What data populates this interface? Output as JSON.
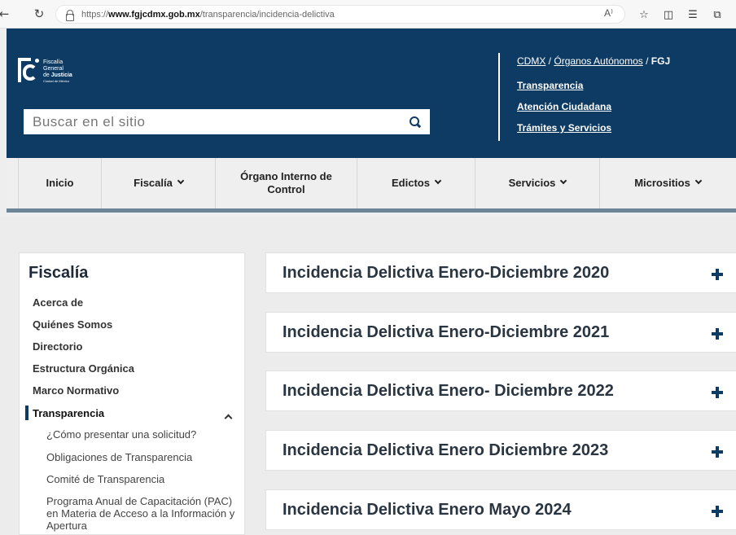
{
  "browser": {
    "url_protocol": "https://",
    "url_host": "www.fgjcdmx.gob.mx",
    "url_path": "/transparencia/incidencia-delictiva",
    "read_aloud_label": "A⁾",
    "toolbar_icons": [
      "favorite-star-icon",
      "split-screen-icon",
      "favorites-list-icon",
      "collections-icon",
      "extensions-icon"
    ]
  },
  "header": {
    "logo": {
      "line1": "Fiscalía",
      "line2": "General",
      "line3_prefix": "de ",
      "line3_bold": "Justicia",
      "line4": "Ciudad de México"
    },
    "search": {
      "placeholder": "Buscar en el sitio"
    },
    "breadcrumb": {
      "part1": "CDMX",
      "sep1": " / ",
      "part2": "Órganos Autónomos",
      "sep2": " / ",
      "part3": "FGJ"
    },
    "links": [
      "Transparencia",
      "Atención Ciudadana",
      "Trámites y Servicios"
    ]
  },
  "main_nav": {
    "items": [
      {
        "label": "Inicio"
      },
      {
        "label": "Fiscalía"
      },
      {
        "label": "Órgano Interno de Control"
      },
      {
        "label": "Edictos"
      },
      {
        "label": "Servicios"
      },
      {
        "label": "Micrositios"
      }
    ]
  },
  "sidebar": {
    "title": "Fiscalía",
    "items": [
      "Acerca de",
      "Quiénes Somos",
      "Directorio",
      "Estructura Orgánica",
      "Marco Normativo",
      "Transparencia"
    ],
    "active_item": "Transparencia",
    "sub_items": [
      "¿Cómo presentar una solicitud?",
      "Obligaciones de Transparencia",
      "Comité de Transparencia",
      "Programa Anual de Capacitación (PAC) en Materia de Acceso a la Información y Apertura"
    ]
  },
  "accordion": {
    "items": [
      "Incidencia Delictiva Enero-Diciembre 2020",
      "Incidencia Delictiva Enero-Diciembre 2021",
      "Incidencia Delictiva Enero- Diciembre 2022",
      "Incidencia Delictiva Enero Diciembre 2023",
      "Incidencia Delictiva Enero Mayo 2024"
    ]
  },
  "colors": {
    "header_bg": "#0d3b63",
    "nav_bg": "#efefef",
    "page_bg": "#ececec",
    "accent": "#0d3b63"
  }
}
